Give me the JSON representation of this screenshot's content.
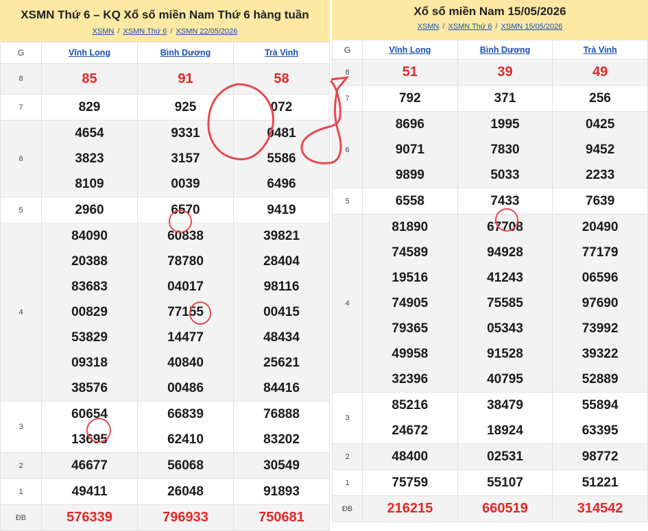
{
  "left": {
    "title": "XSMN Thứ 6 – KQ Xổ số miền Nam Thứ 6 hàng tuần",
    "breadcrumb": [
      "XSMN",
      "XSMN Thứ 6",
      "XSMN 22/05/2026"
    ],
    "separator": "/",
    "header_g": "G",
    "provinces": [
      "Vĩnh Long",
      "Bình Dương",
      "Trà Vinh"
    ],
    "rows": [
      {
        "g": "8",
        "values": [
          [
            "85"
          ],
          [
            "91"
          ],
          [
            "58"
          ]
        ]
      },
      {
        "g": "7",
        "values": [
          [
            "829"
          ],
          [
            "925"
          ],
          [
            "072"
          ]
        ]
      },
      {
        "g": "6",
        "values": [
          [
            "4654",
            "3823",
            "8109"
          ],
          [
            "9331",
            "3157",
            "0039"
          ],
          [
            "0481",
            "5586",
            "6496"
          ]
        ]
      },
      {
        "g": "5",
        "values": [
          [
            "2960"
          ],
          [
            "6570"
          ],
          [
            "9419"
          ]
        ]
      },
      {
        "g": "4",
        "values": [
          [
            "84090",
            "20388",
            "83683",
            "00829",
            "53829",
            "09318",
            "38576"
          ],
          [
            "60838",
            "78780",
            "04017",
            "77155",
            "14477",
            "40840",
            "00486"
          ],
          [
            "39821",
            "28404",
            "98116",
            "00415",
            "48434",
            "25621",
            "84416"
          ]
        ]
      },
      {
        "g": "3",
        "values": [
          [
            "60654",
            "13695"
          ],
          [
            "66839",
            "62410"
          ],
          [
            "76888",
            "83202"
          ]
        ]
      },
      {
        "g": "2",
        "values": [
          [
            "46677"
          ],
          [
            "56068"
          ],
          [
            "30549"
          ]
        ]
      },
      {
        "g": "1",
        "values": [
          [
            "49411"
          ],
          [
            "26048"
          ],
          [
            "91893"
          ]
        ]
      },
      {
        "g": "ĐB",
        "values": [
          [
            "576339"
          ],
          [
            "796933"
          ],
          [
            "750681"
          ]
        ]
      }
    ]
  },
  "right": {
    "title": "Xổ số miền Nam 15/05/2026",
    "breadcrumb": [
      "XSMN",
      "XSMN Thứ 6",
      "XSMN 15/05/2026"
    ],
    "separator": "/",
    "header_g": "G",
    "provinces": [
      "Vĩnh Long",
      "Bình Dương",
      "Trà Vinh"
    ],
    "rows": [
      {
        "g": "8",
        "values": [
          [
            "51"
          ],
          [
            "39"
          ],
          [
            "49"
          ]
        ]
      },
      {
        "g": "7",
        "values": [
          [
            "792"
          ],
          [
            "371"
          ],
          [
            "256"
          ]
        ]
      },
      {
        "g": "6",
        "values": [
          [
            "8696",
            "9071",
            "9899"
          ],
          [
            "1995",
            "7830",
            "5033"
          ],
          [
            "0425",
            "9452",
            "2233"
          ]
        ]
      },
      {
        "g": "5",
        "values": [
          [
            "6558"
          ],
          [
            "7433"
          ],
          [
            "7639"
          ]
        ]
      },
      {
        "g": "4",
        "values": [
          [
            "81890",
            "74589",
            "19516",
            "74905",
            "79365",
            "49958",
            "32396"
          ],
          [
            "67708",
            "94928",
            "41243",
            "75585",
            "05343",
            "91528",
            "40795"
          ],
          [
            "20490",
            "77179",
            "06596",
            "97690",
            "73992",
            "39322",
            "52889"
          ]
        ]
      },
      {
        "g": "3",
        "values": [
          [
            "85216",
            "24672"
          ],
          [
            "38479",
            "18924"
          ],
          [
            "55894",
            "63395"
          ]
        ]
      },
      {
        "g": "2",
        "values": [
          [
            "48400"
          ],
          [
            "02531"
          ],
          [
            "98772"
          ]
        ]
      },
      {
        "g": "1",
        "values": [
          [
            "75759"
          ],
          [
            "55107"
          ],
          [
            "51221"
          ]
        ]
      },
      {
        "g": "ĐB",
        "values": [
          [
            "216215"
          ],
          [
            "660519"
          ],
          [
            "314542"
          ]
        ]
      }
    ]
  },
  "colors": {
    "header_bg": "#fde9a4",
    "accent_red": "#e32727",
    "link_blue": "#1a4fb0",
    "annotation_red": "#e8474f"
  }
}
